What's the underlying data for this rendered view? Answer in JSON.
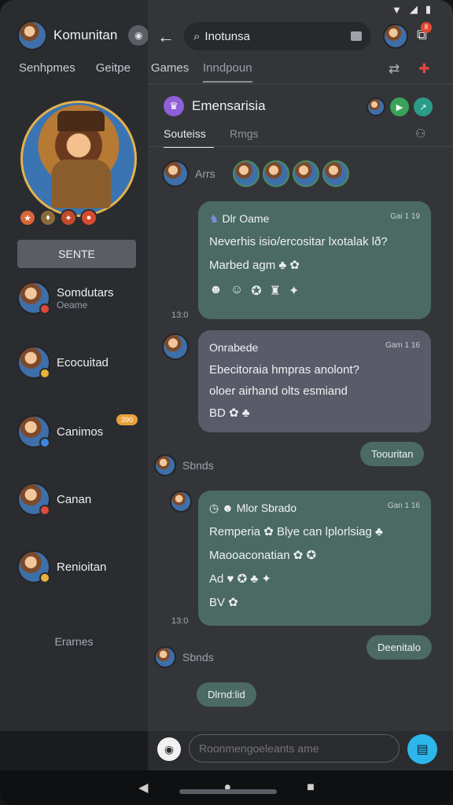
{
  "app": {
    "title": "Komunitan"
  },
  "tabs": [
    "Senhpmes",
    "Geitpe",
    "Games"
  ],
  "active_tab": "Inndpoun",
  "left": {
    "cta_label": "SENTE",
    "friends": [
      {
        "name": "Somdutars",
        "sub": "Oeame",
        "status_color": "#e0493a"
      },
      {
        "name": "Ecocuitad",
        "sub": "",
        "status_color": "#e8b23a"
      },
      {
        "name": "Canimos",
        "sub": "",
        "status_color": "#3a86e0"
      },
      {
        "name": "Canan",
        "sub": "",
        "status_color": "#e0493a"
      },
      {
        "name": "Renioitan",
        "sub": "",
        "status_color": "#e8b23a"
      }
    ],
    "count_badge": "390",
    "footer": "Erarnes"
  },
  "top": {
    "search_value": "Inotunsa",
    "notif_badge": "8"
  },
  "group": {
    "title": "Emensarisia"
  },
  "subtabs": {
    "active": "Souteiss",
    "other": "Rmgs"
  },
  "chat": {
    "sender1": "Arrs",
    "msg1": {
      "title": "Dlr Oame",
      "time": "Gai 1 19",
      "line1": "Neverhis isio/ercositar lxotalak lð?",
      "line2": "Marbed agm",
      "stamp": "13:0"
    },
    "msg2": {
      "title": "Onrabede",
      "time": "Gam 1 16",
      "line1": "Ebecitoraia hmpras anolont?",
      "line2": "oloer airhand olts esmiand",
      "line3": "BD",
      "stamp": ""
    },
    "chip1": "Toouritan",
    "sender2": "Sbnds",
    "msg3": {
      "title": "Mlor Sbrado",
      "time": "Gan 1 16",
      "line1": "Remperia",
      "line1b": "Blye can lplorlsiag",
      "line2": "Maooaconatian",
      "line3": "Ad",
      "line4": "BV",
      "stamp": "13:0"
    },
    "chip2": "Deenitalo",
    "sender3": "Sbnds",
    "chip3": "Dlrnd:lid"
  },
  "composer": {
    "placeholder": "Roonmengoeleants ame"
  },
  "colors": {
    "accent_green": "#4b6a63",
    "accent_blue": "#2db6ea",
    "bubble_grey": "#595c68"
  }
}
